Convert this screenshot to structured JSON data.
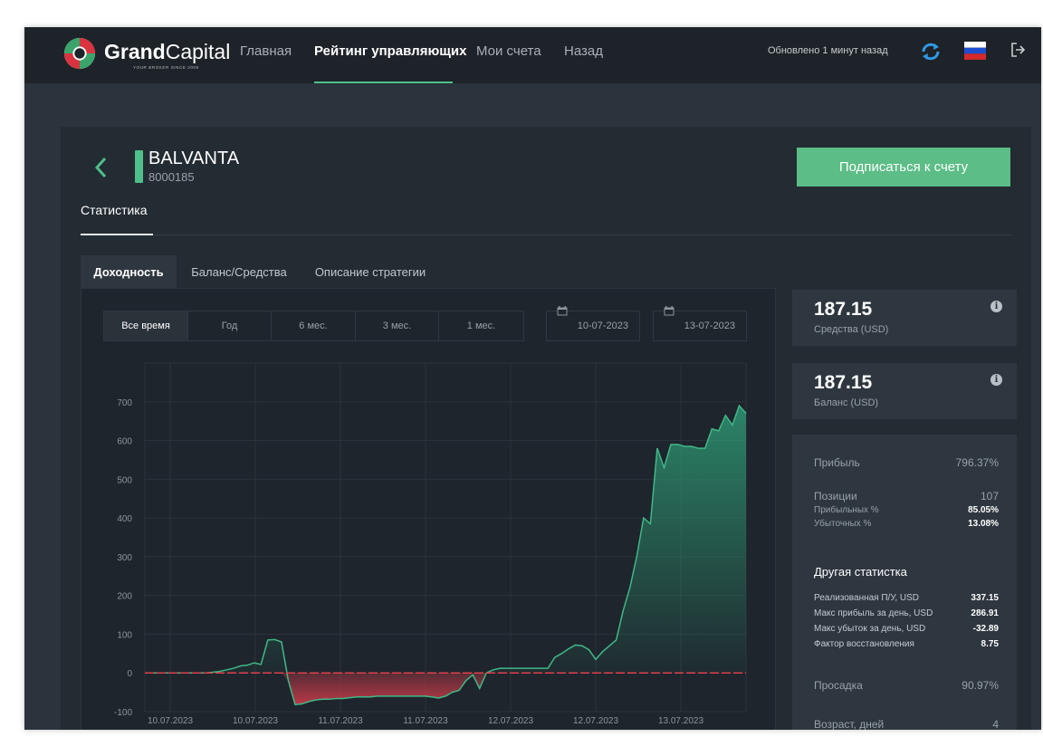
{
  "brand": {
    "name_bold": "Grand",
    "name_regular": "Capital",
    "tagline": "YOUR BROKER    SINCE 2006"
  },
  "nav": {
    "items": [
      {
        "label": "Главная"
      },
      {
        "label": "Рейтинг управляющих"
      },
      {
        "label": "Мои счета"
      },
      {
        "label": "Назад"
      }
    ],
    "active_index": 1,
    "updated": "Обновлено 1 минут назад"
  },
  "account": {
    "name": "BALVANTA",
    "id": "8000185"
  },
  "subscribe_label": "Подписаться к счету",
  "statistics_tab": "Статистика",
  "subtabs": [
    {
      "label": "Доходность"
    },
    {
      "label": "Баланс/Средства"
    },
    {
      "label": "Описание стратегии"
    }
  ],
  "periods": [
    {
      "label": "Все время"
    },
    {
      "label": "Год"
    },
    {
      "label": "6 мес."
    },
    {
      "label": "3 мес."
    },
    {
      "label": "1 мес."
    }
  ],
  "date_from": "10-07-2023",
  "date_to": "13-07-2023",
  "equity": {
    "value": "187.15",
    "label": "Средства (USD)"
  },
  "balance": {
    "value": "187.15",
    "label": "Баланс (USD)"
  },
  "stats": {
    "profit_label": "Прибыль",
    "profit_value": "796.37%",
    "positions_label": "Позиции",
    "positions_value": "107",
    "win_label": "Прибыльных %",
    "win_value": "85.05%",
    "loss_label": "Убыточных %",
    "loss_value": "13.08%",
    "other_title": "Другая статистка",
    "realized_label": "Реализованная П/У, USD",
    "realized_value": "337.15",
    "max_profit_label": "Макс прибыль за день, USD",
    "max_profit_value": "286.91",
    "max_loss_label": "Макс убыток за день, USD",
    "max_loss_value": "-32.89",
    "recovery_label": "Фактор восстановления",
    "recovery_value": "8.75",
    "drawdown_label": "Просадка",
    "drawdown_value": "90.97%",
    "age_label": "Возраст, дней",
    "age_value": "4"
  },
  "colors": {
    "accent": "#4fbf8b",
    "positive": "#2fa37a",
    "negative": "#c23a48",
    "zero_line": "#e0404a"
  },
  "chart_data": {
    "type": "area",
    "ylim": [
      -100,
      800
    ],
    "yticks": [
      -100,
      0,
      100,
      200,
      300,
      400,
      500,
      600,
      700
    ],
    "x_tick_labels": [
      "10.07.2023",
      "10.07.2023",
      "11.07.2023",
      "11.07.2023",
      "12.07.2023",
      "12.07.2023",
      "13.07.2023"
    ],
    "series": [
      {
        "values": [
          0,
          0,
          0,
          0,
          0,
          0,
          0,
          0,
          0,
          0,
          2,
          4,
          8,
          12,
          18,
          20,
          26,
          22,
          85,
          86,
          80,
          -20,
          -82,
          -80,
          -74,
          -70,
          -68,
          -68,
          -66,
          -66,
          -64,
          -62,
          -62,
          -62,
          -60,
          -60,
          -60,
          -60,
          -60,
          -60,
          -60,
          -60,
          -62,
          -65,
          -60,
          -50,
          -45,
          -20,
          -5,
          -40,
          0,
          8,
          12,
          12,
          12,
          12,
          12,
          12,
          12,
          12,
          40,
          50,
          62,
          72,
          70,
          60,
          35,
          55,
          70,
          85,
          160,
          220,
          300,
          400,
          385,
          580,
          530,
          590,
          590,
          585,
          585,
          580,
          580,
          630,
          625,
          665,
          640,
          690,
          670
        ]
      }
    ]
  }
}
